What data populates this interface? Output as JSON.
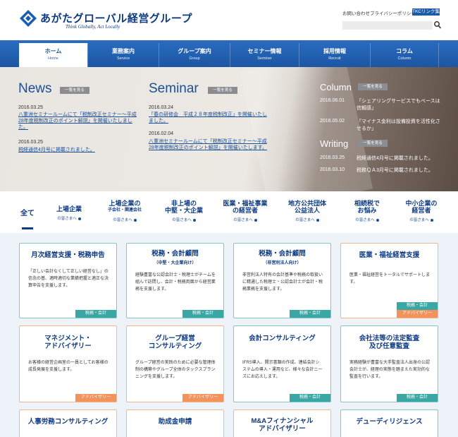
{
  "header": {
    "logo_name": "あがたグローバル経営グループ",
    "logo_tagline": "Think Globally, Act Locally",
    "contact": "お問い合わせ",
    "privacy": "プライバシーポリシー",
    "tkc": "TKCリンク集",
    "search_placeholder": ""
  },
  "nav": [
    {
      "jp": "ホーム",
      "en": "Home"
    },
    {
      "jp": "業務案内",
      "en": "Service"
    },
    {
      "jp": "グループ案内",
      "en": "Group"
    },
    {
      "jp": "セミナー情報",
      "en": "Seminer"
    },
    {
      "jp": "採用情報",
      "en": "Recruit"
    },
    {
      "jp": "コラム",
      "en": "Column"
    }
  ],
  "hero": {
    "news": {
      "title": "News",
      "more": "一覧を見る",
      "items": [
        {
          "date": "2016.03.25",
          "text": "八重洲セミナールームにて「税制改正セミナー～平成28年度税制改正のポイント解説」を開催いたしました。"
        },
        {
          "date": "2016.03.25",
          "text": "税経通信4月号に掲載されました。"
        }
      ]
    },
    "seminar": {
      "title": "Seminar",
      "more": "一覧を見る",
      "items": [
        {
          "date": "2016.03.24",
          "text": "「春の研修会　平成２８年度税制改正」を開催いたしました。"
        },
        {
          "date": "2016.02.04",
          "text": "八重洲セミナールームにて「税制改正セミナー～平成28年度税制改正のポイント解説」を開催いたします。"
        }
      ]
    },
    "column": {
      "title": "Column",
      "more": "一覧を見る",
      "items": [
        {
          "date": "2016.06.01",
          "text": "「シェアリングサービスでもベースは信頼感」"
        },
        {
          "date": "2016.05.02",
          "text": "「マイナス金利は設備投資を活性化させるか」"
        }
      ]
    },
    "writing": {
      "title": "Writing",
      "more": "一覧を見る",
      "items": [
        {
          "date": "2016.03.25",
          "text": "税経通信4月号に掲載されました。"
        },
        {
          "date": "2016.03.10",
          "text": "税務ＱＡ3月号に掲載されました。"
        }
      ]
    }
  },
  "categories": {
    "all": "全て",
    "items": [
      {
        "l1": "上場企業",
        "l2": "",
        "sub": "の皆さまへ"
      },
      {
        "l1": "上場企業の",
        "l2": "子会社・関連会社",
        "sub": "の皆さまへ"
      },
      {
        "l1": "非上場の",
        "l2": "中堅・大企業",
        "sub": "の皆さまへ"
      },
      {
        "l1": "医業・福祉事業",
        "l2": "の経営者",
        "sub": "の皆さまへ"
      },
      {
        "l1": "地方公共団体",
        "l2": "公益法人",
        "sub": "の皆さまへ"
      },
      {
        "l1": "相続税で",
        "l2": "お悩み",
        "sub": "の皆さまへ"
      },
      {
        "l1": "中小企業の",
        "l2": "経営者",
        "sub": "の皆さまへ"
      }
    ]
  },
  "cards": [
    {
      "title": "月次経営支援・税務申告",
      "sub": "",
      "desc": "「正しい会計なくして正しい経営なし」の信念の基、適時適切な業績把握と適正な決算申告を支援します。",
      "tags": [
        "税務・会計"
      ]
    },
    {
      "title": "税務・会計顧問",
      "sub": "（中堅・大企業向け）",
      "desc": "経験豊富な公認会計士・税理士がチームを組んで訪問し、会計・税務両面から経営業務を支援します。",
      "tags": [
        "税務・会計"
      ]
    },
    {
      "title": "税務・会計顧問",
      "sub": "（非営利法人向け）",
      "desc": "非営利法人特有の会計基準や税務の取扱いに精通した税理士・公認会計士が会計・税務業務を支援します。",
      "tags": [
        "税務・会計"
      ]
    },
    {
      "title": "医業・福祉経営支援",
      "sub": "",
      "desc": "医業・福祉経営をトータルでサポートします。",
      "tags": [
        "税務・会計",
        "アドバイザリー"
      ]
    },
    {
      "title": "マネジメント・\nアドバイザリー",
      "sub": "",
      "desc": "お客様の経営企画室の一員としてお客様の成長発展を支援します。",
      "tags": [
        "アドバイザリー"
      ]
    },
    {
      "title": "グループ経営\nコンサルティング",
      "sub": "",
      "desc": "グループ経営の実践のために必要な管理体制の構築やグループ全体のタックスプランニングを支援します。",
      "tags": [
        "アドバイザリー"
      ]
    },
    {
      "title": "会計コンサルティング",
      "sub": "",
      "desc": "IFRS導入、開示書類の作成、連結会計システムの導入・運用など、様々な会計ニーズにお応えします。",
      "tags": [
        "税務・会計"
      ]
    },
    {
      "title": "会社法等の法定監査\n及び任意監査",
      "sub": "",
      "desc": "実務経験が豊富な大手監査法人出身の公認会計士が、経理の実態を踏まえた実効的な監査を行います。",
      "tags": [
        "税務・会計"
      ]
    },
    {
      "title": "人事労務コンサルティング",
      "sub": "",
      "desc": "",
      "tags": []
    },
    {
      "title": "助成金申請",
      "sub": "",
      "desc": "",
      "tags": []
    },
    {
      "title": "M&Aフィナンシャル\nアドバイザリー",
      "sub": "",
      "desc": "",
      "tags": []
    },
    {
      "title": "デューディリジェンス",
      "sub": "",
      "desc": "",
      "tags": []
    }
  ],
  "colors": {
    "brand": "#0d3a82",
    "nav": "#1c56a3",
    "teal": "#3aa7a5",
    "orange": "#f1935a"
  }
}
